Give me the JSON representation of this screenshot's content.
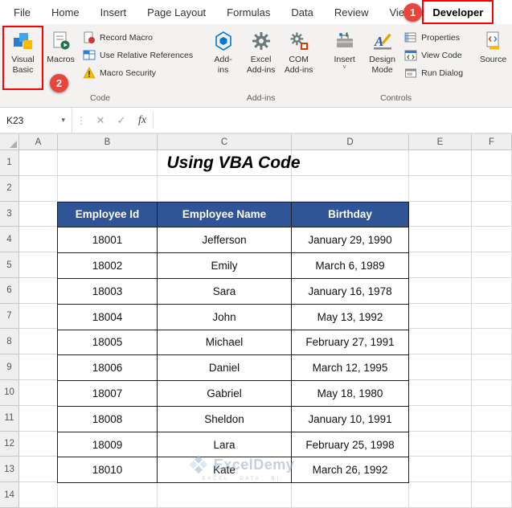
{
  "ribbon": {
    "tabs": [
      {
        "label": "File"
      },
      {
        "label": "Home"
      },
      {
        "label": "Insert"
      },
      {
        "label": "Page Layout"
      },
      {
        "label": "Formulas"
      },
      {
        "label": "Data"
      },
      {
        "label": "Review"
      },
      {
        "label": "View"
      },
      {
        "label": "Developer",
        "selected": true
      }
    ],
    "code_group": {
      "label": "Code",
      "visual_basic_line1": "Visual",
      "visual_basic_line2": "Basic",
      "macros": "Macros",
      "record_macro": "Record Macro",
      "use_relative_references": "Use Relative References",
      "macro_security": "Macro Security"
    },
    "addins_group": {
      "label": "Add-ins",
      "addins_line1": "Add-",
      "addins_line2": "ins",
      "excel_addins_line1": "Excel",
      "excel_addins_line2": "Add-ins",
      "com_addins_line1": "COM",
      "com_addins_line2": "Add-ins"
    },
    "controls_group": {
      "label": "Controls",
      "insert": "Insert",
      "design_mode_line1": "Design",
      "design_mode_line2": "Mode",
      "properties": "Properties",
      "view_code": "View Code",
      "run_dialog": "Run Dialog"
    },
    "source_group": {
      "source": "Source"
    }
  },
  "formula_bar": {
    "name_box": "K23",
    "fx_label": "fx"
  },
  "icons": {
    "caret_down": "▾",
    "dots": "⋮",
    "cancel": "✕",
    "check": "✓",
    "chevron_down": "˅"
  },
  "grid": {
    "columns": [
      "A",
      "B",
      "C",
      "D",
      "E",
      "F"
    ],
    "row_labels": [
      "1",
      "2",
      "3",
      "4",
      "5",
      "6",
      "7",
      "8",
      "9",
      "10",
      "11",
      "12",
      "13",
      "14"
    ]
  },
  "sheet": {
    "title": "Using VBA Code",
    "table": {
      "headers": [
        "Employee Id",
        "Employee Name",
        "Birthday"
      ],
      "rows": [
        [
          "18001",
          "Jefferson",
          "January 29, 1990"
        ],
        [
          "18002",
          "Emily",
          "March 6, 1989"
        ],
        [
          "18003",
          "Sara",
          "January 16, 1978"
        ],
        [
          "18004",
          "John",
          "May 13, 1992"
        ],
        [
          "18005",
          "Michael",
          "February 27, 1991"
        ],
        [
          "18006",
          "Daniel",
          "March 12, 1995"
        ],
        [
          "18007",
          "Gabriel",
          "May 18, 1980"
        ],
        [
          "18008",
          "Sheldon",
          "January 10, 1991"
        ],
        [
          "18009",
          "Lara",
          "February 25, 1998"
        ],
        [
          "18010",
          "Kate",
          "March 26, 1992"
        ]
      ]
    }
  },
  "annotations": {
    "step1": "1",
    "step2": "2"
  },
  "watermark": {
    "name": "ExcelDemy",
    "tagline": "EXCEL · DATA · BI"
  },
  "colors": {
    "table_header_bg": "#2F5597",
    "annotation_red": "#FF0000",
    "badge_red": "#E8453C",
    "ribbon_bg": "#F3F2F1"
  }
}
